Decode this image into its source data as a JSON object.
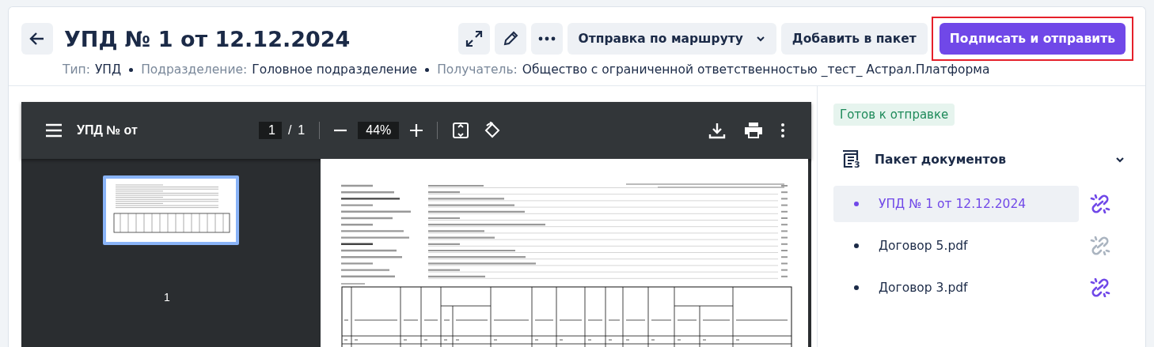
{
  "header": {
    "title": "УПД № 1 от 12.12.2024",
    "meta": [
      {
        "label": "Тип:",
        "value": "УПД"
      },
      {
        "label": "Подразделение:",
        "value": "Головное подразделение"
      },
      {
        "label": "Получатель:",
        "value": "Общество с ограниченной ответственностью _тест_ Астрал.Платформа"
      }
    ],
    "route_button": "Отправка по маршруту",
    "add_button": "Добавить в пакет",
    "primary_button": {
      "label": "Подписать и отправить",
      "highlighted": true
    }
  },
  "viewer": {
    "title": "УПД № от",
    "page": "1",
    "separator": "/",
    "pages": "1",
    "zoom": "44%",
    "thumbnails": [
      {
        "label": "1",
        "selected": true
      }
    ]
  },
  "panel": {
    "status": "Готов к отправке",
    "package": {
      "title": "Пакет документов",
      "count": "3",
      "expanded": true,
      "documents": [
        {
          "name": "УПД № 1 от 12.12.2024",
          "selected": true,
          "linked": true
        },
        {
          "name": "Договор 5.pdf",
          "selected": false,
          "linked": false
        },
        {
          "name": "Договор 3.pdf",
          "selected": false,
          "linked": true
        }
      ]
    }
  }
}
